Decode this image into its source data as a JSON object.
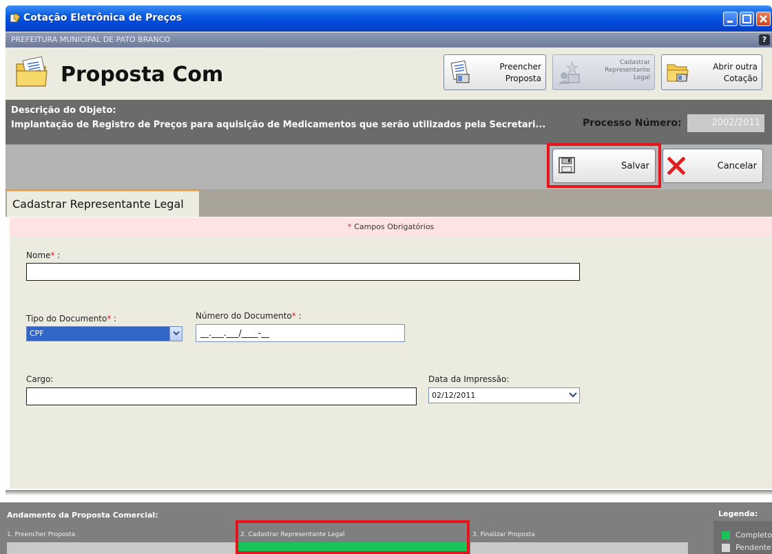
{
  "window": {
    "title": "Cotação Eletrônica de Preços"
  },
  "org": {
    "name": "PREFEITURA MUNICIPAL DE PATO BRANCO",
    "help": "?"
  },
  "header": {
    "title": "Proposta Com",
    "buttons": [
      {
        "label_line1": "Preencher",
        "label_line2": "Proposta"
      },
      {
        "label_line1": "Cadastrar",
        "label_line2": "Representante",
        "label_line3": "Legal"
      },
      {
        "label_line1": "Abrir outra",
        "label_line2": "Cotação"
      }
    ]
  },
  "object": {
    "label": "Descrição do Objeto:",
    "description": "Implantação de Registro de Preços para aquisição de Medicamentos que serão utilizados pela Secretari...",
    "process_label": "Processo Número:",
    "process_number": "2002/2011"
  },
  "actions": {
    "save": "Salvar",
    "cancel": "Cancelar"
  },
  "tab": {
    "label": "Cadastrar Representante Legal"
  },
  "required_note": "Campos Obrigatórios",
  "required_star": "*",
  "form": {
    "name_label": "Nome",
    "name_value": "",
    "doc_type_label": "Tipo do Documento",
    "doc_type_value": "CPF",
    "doc_number_label": "Número do Documento",
    "doc_number_value": "__.___.___/____-__",
    "role_label": "Cargo:",
    "role_value": "",
    "print_date_label": "Data da Impressão:",
    "print_date_value": "02/12/2011",
    "colon": " :"
  },
  "progress": {
    "title": "Andamento da Proposta Comercial:",
    "steps": [
      {
        "label": "1. Preencher Proposta",
        "status": "pendente"
      },
      {
        "label": "2. Cadastrar Representante Legal",
        "status": "completo"
      },
      {
        "label": "3. Finalizar Proposta",
        "status": "pendente"
      }
    ],
    "legend_title": "Legenda:",
    "legend": [
      {
        "label": "Completo",
        "color": "#19c359"
      },
      {
        "label": "Pendente",
        "color": "#d8d8d8"
      }
    ]
  },
  "colors": {
    "highlight": "#e8141c",
    "complete": "#19c359",
    "pending": "#c9c9c9"
  }
}
